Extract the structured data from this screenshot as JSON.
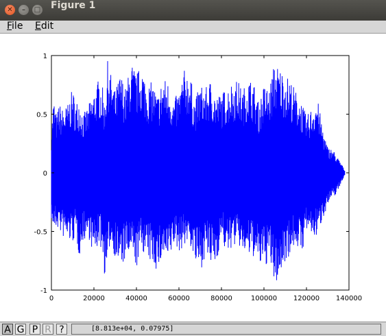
{
  "window": {
    "title": "Figure 1",
    "close_glyph": "✕",
    "min_glyph": "–",
    "max_glyph": "□"
  },
  "menu": {
    "items": [
      "File",
      "Edit"
    ]
  },
  "toolbar": {
    "buttons": [
      {
        "label": "A",
        "state": "pressed"
      },
      {
        "label": "G",
        "state": "normal"
      },
      {
        "label": "P",
        "state": "normal"
      },
      {
        "label": "R",
        "state": "disabled"
      },
      {
        "label": "?",
        "state": "normal"
      }
    ],
    "coordinates": "[8.813e+04, 0.07975]"
  },
  "chart_data": {
    "type": "line",
    "title": "",
    "xlabel": "",
    "ylabel": "",
    "xlim": [
      0,
      140000
    ],
    "ylim": [
      -1,
      1
    ],
    "xticks": [
      0,
      20000,
      40000,
      60000,
      80000,
      100000,
      120000,
      140000
    ],
    "yticks": [
      -1,
      -0.5,
      0,
      0.5,
      1
    ],
    "xtick_labels": [
      "0",
      "20000",
      "40000",
      "60000",
      "80000",
      "100000",
      "120000",
      "140000"
    ],
    "ytick_labels": [
      "-1",
      "-0.5",
      "0",
      "0.5",
      "1"
    ],
    "grid": false,
    "series": [
      {
        "color": "#0000ff",
        "x": [
          0,
          1000,
          2500,
          3500,
          5000,
          7500,
          10000,
          11500,
          13000,
          15000,
          17500,
          20000,
          22500,
          24000,
          25000,
          26500,
          27500,
          30000,
          32500,
          35000,
          37500,
          40000,
          42500,
          45000,
          47500,
          50000,
          52500,
          55000,
          57500,
          60000,
          62500,
          65000,
          67500,
          70000,
          72500,
          75000,
          77500,
          80000,
          82500,
          85000,
          87500,
          90000,
          92500,
          95000,
          97500,
          100000,
          102500,
          105000,
          107500,
          110000,
          112500,
          115000,
          117500,
          120000,
          122500,
          125000,
          127500,
          130000,
          132500,
          135000,
          136500,
          138000
        ],
        "upper": [
          0.35,
          0.65,
          0.48,
          0.6,
          0.55,
          0.58,
          0.72,
          0.6,
          0.65,
          0.5,
          0.58,
          0.7,
          0.82,
          0.74,
          0.6,
          0.97,
          0.88,
          0.7,
          0.86,
          0.72,
          0.96,
          0.85,
          0.93,
          0.75,
          0.78,
          0.66,
          0.82,
          0.78,
          0.62,
          0.7,
          0.88,
          0.86,
          0.62,
          0.76,
          0.72,
          0.8,
          0.66,
          0.68,
          0.73,
          0.78,
          0.8,
          0.7,
          0.82,
          0.78,
          0.6,
          0.75,
          0.73,
          0.95,
          0.9,
          0.84,
          0.8,
          0.7,
          0.62,
          0.48,
          0.56,
          0.65,
          0.4,
          0.22,
          0.2,
          0.12,
          0.08,
          0.02
        ],
        "lower": [
          -0.4,
          -0.5,
          -0.48,
          -0.48,
          -0.55,
          -0.58,
          -0.6,
          -0.55,
          -0.72,
          -0.58,
          -0.55,
          -0.72,
          -0.6,
          -0.7,
          -0.88,
          -0.85,
          -0.6,
          -0.72,
          -0.82,
          -0.75,
          -0.7,
          -0.82,
          -0.65,
          -0.75,
          -0.78,
          -0.85,
          -0.72,
          -0.8,
          -0.62,
          -0.68,
          -0.62,
          -0.6,
          -0.78,
          -0.85,
          -0.7,
          -0.8,
          -0.78,
          -0.55,
          -0.72,
          -0.63,
          -0.62,
          -0.68,
          -0.72,
          -0.72,
          -0.8,
          -0.82,
          -0.75,
          -0.97,
          -0.9,
          -0.75,
          -0.7,
          -0.6,
          -0.72,
          -0.5,
          -0.55,
          -0.55,
          -0.4,
          -0.28,
          -0.22,
          -0.15,
          -0.08,
          -0.02
        ]
      }
    ]
  }
}
